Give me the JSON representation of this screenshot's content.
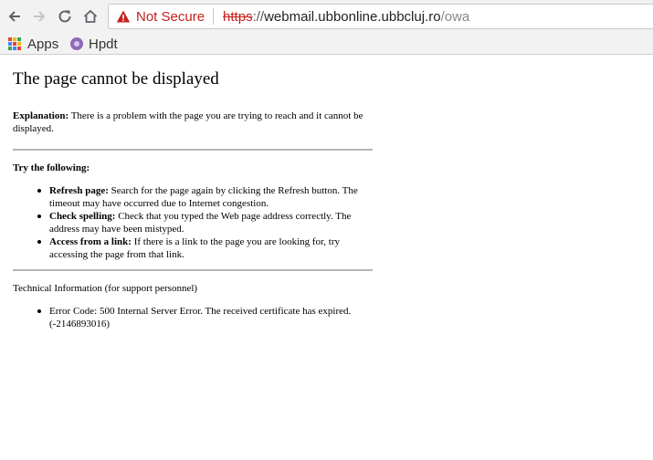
{
  "browser": {
    "security_label": "Not Secure",
    "url_scheme": "https",
    "url_scheme_rest": "://",
    "url_host": "webmail.ubbonline.ubbcluj.ro",
    "url_path": "/owa",
    "colors": {
      "insecure": "#c5221f",
      "toolbar": "#f2f2f2"
    },
    "icons": [
      "back-icon",
      "forward-icon",
      "reload-icon",
      "home-icon",
      "warning-icon"
    ]
  },
  "bookmarks": [
    {
      "label": "Apps",
      "icon": "apps-grid-icon"
    },
    {
      "label": "Hpdt",
      "icon": "hpdt-favicon-icon"
    }
  ],
  "page": {
    "title": "The page cannot be displayed",
    "explanation_label": "Explanation:",
    "explanation_text": " There is a problem with the page you are trying to reach and it cannot be displayed.",
    "try_heading": "Try the following:",
    "suggestions": [
      {
        "label": "Refresh page:",
        "text": " Search for the page again by clicking the Refresh button. The timeout may have occurred due to Internet congestion."
      },
      {
        "label": "Check spelling:",
        "text": " Check that you typed the Web page address correctly. The address may have been mistyped."
      },
      {
        "label": "Access from a link:",
        "text": " If there is a link to the page you are looking for, try accessing the page from that link."
      }
    ],
    "tech_heading": "Technical Information (for support personnel)",
    "error_text": "Error Code: 500 Internal Server Error. The received certificate has expired. (-2146893016)"
  }
}
